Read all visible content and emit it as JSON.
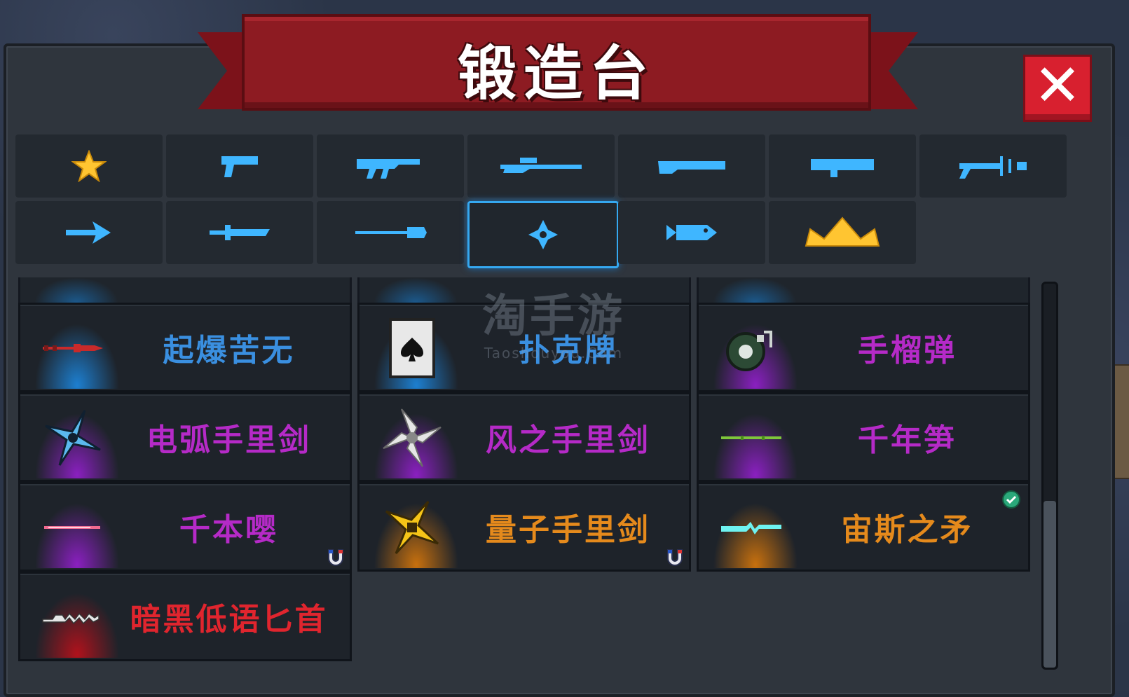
{
  "header": {
    "title": "锻造台",
    "close_label": "✕"
  },
  "tabs": [
    {
      "icon": "star-icon",
      "color": "#ffc531"
    },
    {
      "icon": "pistol-icon",
      "color": "#3fb6ff"
    },
    {
      "icon": "assault-rifle-icon",
      "color": "#3fb6ff"
    },
    {
      "icon": "sniper-rifle-icon",
      "color": "#3fb6ff"
    },
    {
      "icon": "shotgun-icon",
      "color": "#3fb6ff"
    },
    {
      "icon": "rocket-launcher-icon",
      "color": "#3fb6ff"
    },
    {
      "icon": "staff-weapon-icon",
      "color": "#3fb6ff"
    },
    {
      "icon": "bow-arrow-icon",
      "color": "#3fb6ff"
    },
    {
      "icon": "sword-icon",
      "color": "#3fb6ff"
    },
    {
      "icon": "spear-icon",
      "color": "#3fb6ff"
    },
    {
      "icon": "throwing-star-icon",
      "color": "#3fb6ff",
      "selected": true
    },
    {
      "icon": "fish-icon",
      "color": "#3fb6ff"
    },
    {
      "icon": "crown-icon",
      "color": "#ffc531"
    }
  ],
  "items": [
    {
      "name": "起爆苦无",
      "color": "#3a8fe0",
      "rarity": "blue",
      "icon": "kunai-icon"
    },
    {
      "name": "扑克牌",
      "color": "#3a8fe0",
      "rarity": "blue",
      "icon": "playing-card-icon"
    },
    {
      "name": "手榴弹",
      "color": "#b52ac7",
      "rarity": "purple",
      "icon": "grenade-icon"
    },
    {
      "name": "电弧手里剑",
      "color": "#b52ac7",
      "rarity": "purple",
      "icon": "arc-shuriken-icon"
    },
    {
      "name": "风之手里剑",
      "color": "#b52ac7",
      "rarity": "purple",
      "icon": "wind-shuriken-icon"
    },
    {
      "name": "千年笋",
      "color": "#b52ac7",
      "rarity": "purple",
      "icon": "bamboo-needle-icon"
    },
    {
      "name": "千本嘤",
      "color": "#b52ac7",
      "rarity": "purple",
      "icon": "senbon-needle-icon",
      "badge": "magnet-icon"
    },
    {
      "name": "量子手里剑",
      "color": "#e58a1c",
      "rarity": "orange",
      "icon": "quantum-shuriken-icon",
      "badge": "magnet-icon"
    },
    {
      "name": "宙斯之矛",
      "color": "#e58a1c",
      "rarity": "orange",
      "icon": "zeus-spear-icon",
      "badge": "check-icon"
    },
    {
      "name": "暗黑低语匕首",
      "color": "#e0252e",
      "rarity": "red",
      "icon": "dark-dagger-icon"
    }
  ],
  "watermark": {
    "main": "淘手游",
    "sub": "Taoshouyou.Com"
  }
}
